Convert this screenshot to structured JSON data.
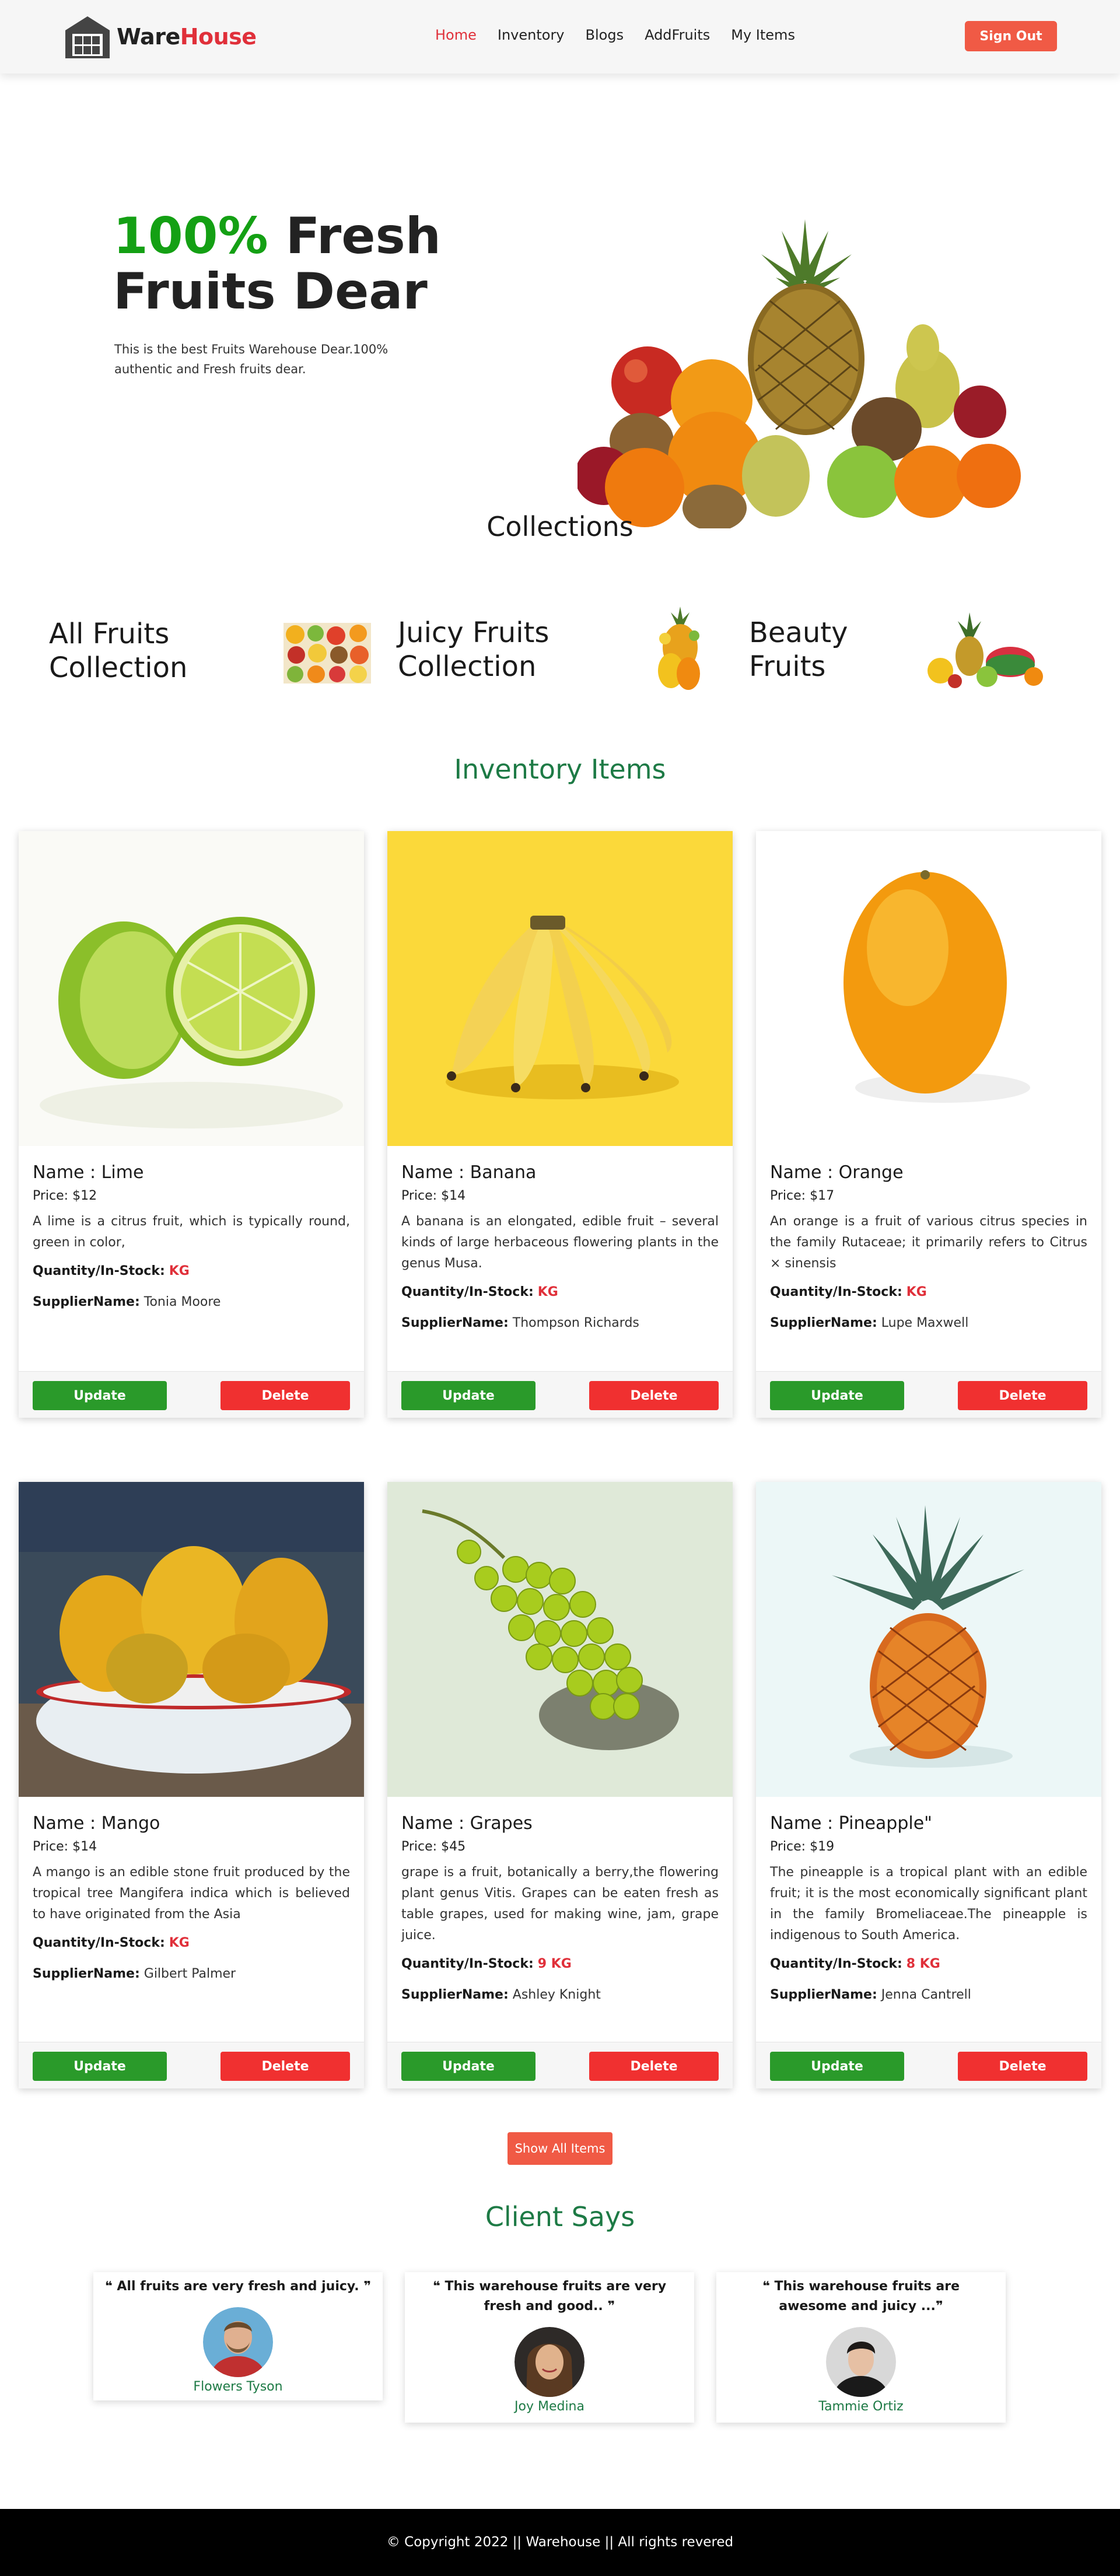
{
  "navbar": {
    "brand_part1": "Ware",
    "brand_part2": "House",
    "links": [
      "Home",
      "Inventory",
      "Blogs",
      "AddFruits",
      "My Items"
    ],
    "signout_label": "Sign Out"
  },
  "hero": {
    "title_highlight": "100%",
    "title_rest_1": " Fresh",
    "title_line2": "Fruits Dear",
    "description": "This is the best Fruits Warehouse Dear.100% authentic and Fresh fruits dear."
  },
  "collections": {
    "title": "Collections",
    "items": [
      {
        "line1": "All Fruits",
        "line2": "Collection"
      },
      {
        "line1": "Juicy Fruits",
        "line2": "Collection"
      },
      {
        "line1": "Beauty",
        "line2": "Fruits"
      }
    ]
  },
  "inventory": {
    "title": "Inventory Items",
    "price_label": "Price: ",
    "quantity_label": "Quantity/In-Stock:",
    "supplier_label": "SupplierName:",
    "update_label": "Update",
    "delete_label": "Delete",
    "items": [
      {
        "name": "Name : Lime",
        "price": "$12",
        "description": "A lime is a citrus fruit, which is typically round, green in color,",
        "quantity": "KG",
        "supplier": "Tonia Moore"
      },
      {
        "name": "Name : Banana",
        "price": "$14",
        "description": "A banana is an elongated, edible fruit – several kinds of large herbaceous flowering plants in the genus Musa.",
        "quantity": "KG",
        "supplier": "Thompson Richards"
      },
      {
        "name": "Name : Orange",
        "price": "$17",
        "description": "An orange is a fruit of various citrus species in the family Rutaceae; it primarily refers to Citrus × sinensis",
        "quantity": "KG",
        "supplier": "Lupe Maxwell"
      },
      {
        "name": "Name : Mango",
        "price": "$14",
        "description": "A mango is an edible stone fruit produced by the tropical tree Mangifera indica which is believed to have originated from the Asia",
        "quantity": "KG",
        "supplier": "Gilbert Palmer"
      },
      {
        "name": "Name : Grapes",
        "price": "$45",
        "description": "grape is a fruit, botanically a berry,the flowering plant genus Vitis. Grapes can be eaten fresh as table grapes, used for making wine, jam, grape juice.",
        "quantity": "9 KG",
        "supplier": "Ashley Knight"
      },
      {
        "name": "Name : Pineapple\"",
        "price": "$19",
        "description": "The pineapple is a tropical plant with an edible fruit; it is the most economically significant plant in the family Bromeliaceae.The pineapple is indigenous to South America.",
        "quantity": "8 KG",
        "supplier": "Jenna Cantrell"
      }
    ],
    "show_all_label": "Show All Items"
  },
  "clients": {
    "title": "Client Says",
    "reviews": [
      {
        "quote": "❝ All fruits are very fresh and juicy. ❞",
        "name": "Flowers Tyson"
      },
      {
        "quote": "❝ This warehouse fruits are very fresh and good.. ❞",
        "name": "Joy Medina"
      },
      {
        "quote": "❝ This warehouse fruits are awesome and juicy ...❞",
        "name": "Tammie Ortiz"
      }
    ]
  },
  "footer": {
    "text": "© Copyright 2022 || Warehouse || All rights revered"
  },
  "colors": {
    "accent_red": "#e0303a",
    "button_orange": "#f05a45",
    "title_green": "#1d7a45",
    "update_green": "#2a9a2a",
    "delete_red": "#f03030"
  }
}
